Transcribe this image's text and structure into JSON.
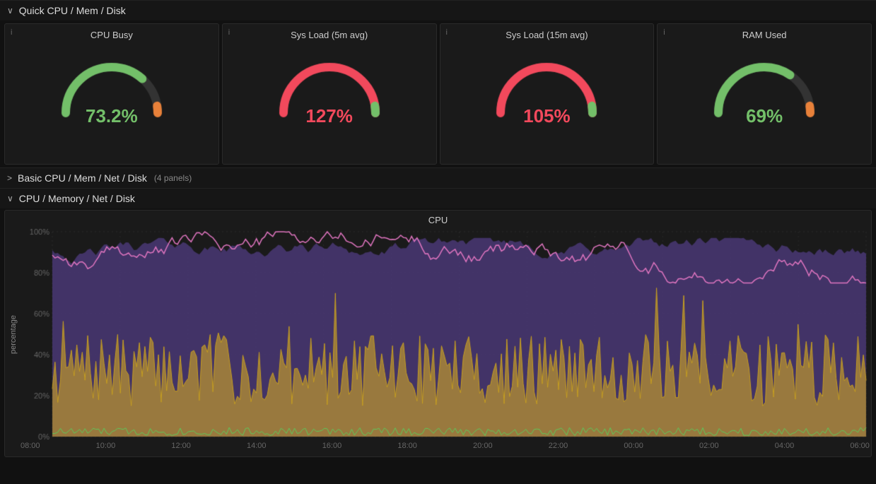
{
  "sections": {
    "quick": {
      "label": "Quick CPU / Mem / Disk",
      "arrow": "∨"
    },
    "basic": {
      "label": "Basic CPU / Mem / Net / Disk",
      "arrow": ">",
      "panels_count": "(4 panels)"
    },
    "cpu_memory": {
      "label": "CPU / Memory / Net / Disk",
      "arrow": "∨"
    }
  },
  "gauges": [
    {
      "title": "CPU Busy",
      "value": "73.2%",
      "value_class": "green-val",
      "arc_color": "#73bf69",
      "bg_arc_color": "#e8813a",
      "percent": 0.732
    },
    {
      "title": "Sys Load (5m avg)",
      "value": "127%",
      "value_class": "red-val",
      "arc_color": "#f2495c",
      "bg_arc_color": "#73bf69",
      "percent": 1.0
    },
    {
      "title": "Sys Load (15m avg)",
      "value": "105%",
      "value_class": "red-val",
      "arc_color": "#f2495c",
      "bg_arc_color": "#73bf69",
      "percent": 1.0
    },
    {
      "title": "RAM Used",
      "value": "69%",
      "value_class": "green-val",
      "arc_color": "#73bf69",
      "bg_arc_color": "#e8813a",
      "percent": 0.69
    }
  ],
  "chart": {
    "title": "CPU",
    "y_label": "percentage",
    "y_ticks": [
      "100%",
      "80%",
      "60%",
      "40%",
      "20%",
      "0%"
    ],
    "x_ticks": [
      "08:00",
      "10:00",
      "12:00",
      "14:00",
      "16:00",
      "18:00",
      "20:00",
      "22:00",
      "00:00",
      "02:00",
      "04:00",
      "06:00"
    ]
  }
}
